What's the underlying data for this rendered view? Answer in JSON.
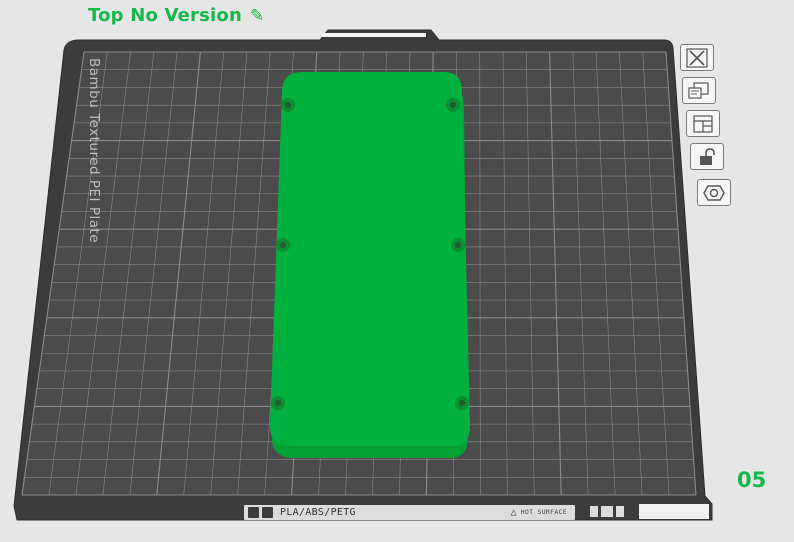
{
  "header": {
    "title": "Top No Version",
    "edit_icon": "pencil-icon"
  },
  "plate": {
    "label": "Bambu Textured PEI Plate",
    "number": "05",
    "bed_color": "#4b4b4b",
    "grid_color": "#8a8a8a",
    "part_color": "#00b140"
  },
  "toolbar": [
    {
      "name": "delete-plate-button",
      "icon": "close-icon"
    },
    {
      "name": "arrange-button",
      "icon": "arrange-icon"
    },
    {
      "name": "orient-button",
      "icon": "layout-icon"
    },
    {
      "name": "lock-button",
      "icon": "unlock-icon"
    },
    {
      "name": "plate-settings-button",
      "icon": "gear-icon"
    }
  ],
  "footer": {
    "materials": "PLA/ABS/PETG",
    "warning_icon": "warning-icon",
    "surface_label": "HOT SURFACE"
  }
}
